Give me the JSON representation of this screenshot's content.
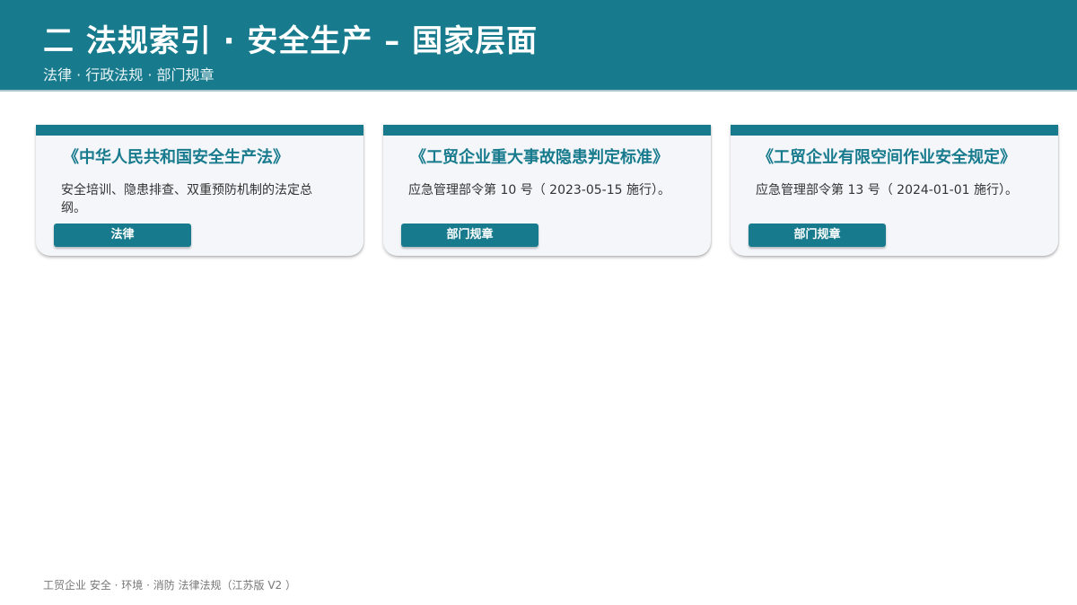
{
  "header": {
    "title": "二  法规索引  ·  安全生产 – 国家层面",
    "subtitle": "法律  ·  行政法规  ·  部门规章"
  },
  "cards": [
    {
      "title": "《中华人民共和国安全生产法》",
      "description": "安全培训、隐患排查、双重预防机制的法定总纲。",
      "tag": "法律"
    },
    {
      "title": "《工贸企业重大事故隐患判定标准》",
      "description": "应急管理部令第 10 号（ 2023-05-15 施行）。",
      "tag": "部门规章"
    },
    {
      "title": "《工贸企业有限空间作业安全规定》",
      "description": "应急管理部令第 13 号（ 2024-01-01 施行）。",
      "tag": "部门规章"
    }
  ],
  "footer": {
    "text": "工贸企业 安全 · 环境 · 消防 法律法规（江苏版  V2 ）"
  },
  "colors": {
    "primary": "#177b8d",
    "card_bg": "#f4f6fa"
  }
}
